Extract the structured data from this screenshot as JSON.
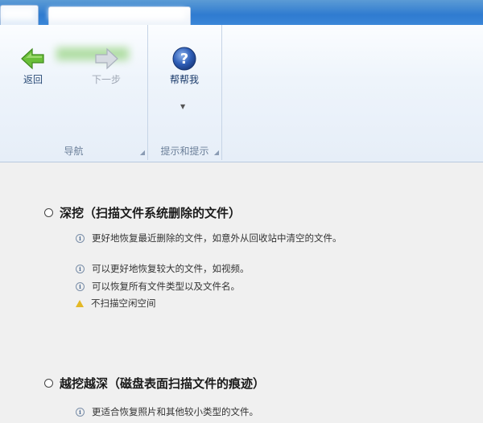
{
  "ribbon": {
    "groups": {
      "navigation": "导航",
      "help": "提示和提示"
    },
    "buttons": {
      "back": "返回",
      "next": "下一步",
      "help": "帮帮我"
    }
  },
  "options": {
    "deep": {
      "title": "深挖（扫描文件系统删除的文件）",
      "details": [
        "更好地恢复最近删除的文件，如意外从回收站中清空的文件。",
        "可以更好地恢复较大的文件，如视频。",
        "可以恢复所有文件类型以及文件名。",
        "不扫描空闲空间"
      ]
    },
    "deeper": {
      "title": "越挖越深（磁盘表面扫描文件的痕迹）",
      "details": [
        "更适合恢复照片和其他较小类型的文件。"
      ]
    }
  },
  "icons": {
    "back": "green-left-arrow-icon",
    "next": "gray-right-arrow-icon",
    "help": "blue-question-icon",
    "info": "info-icon",
    "warning": "warning-icon"
  },
  "colors": {
    "accent": "#2f7bd0",
    "ribbon": "#eef4fb",
    "content": "#f0f0f0",
    "warning": "#e3b826"
  }
}
